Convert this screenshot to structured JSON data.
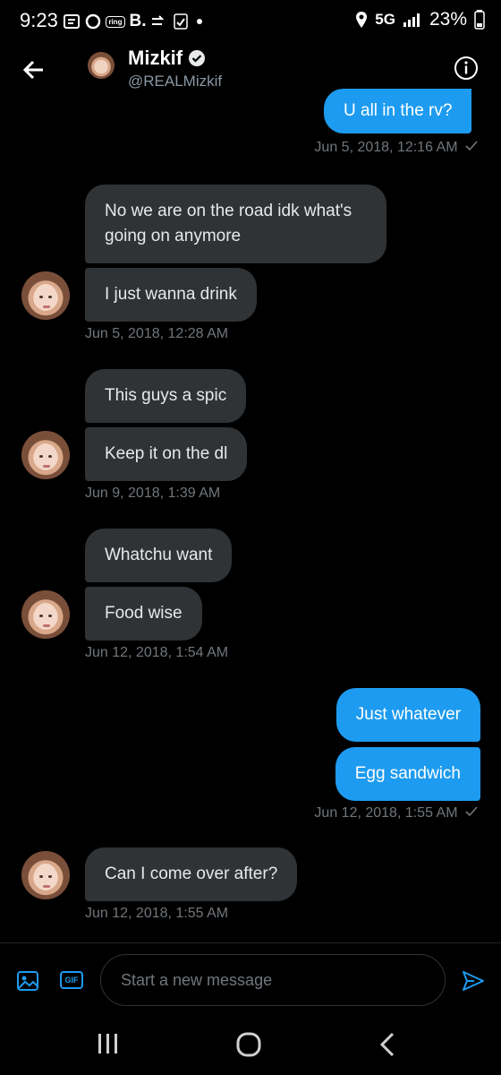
{
  "status_bar": {
    "time": "9:23",
    "notif_icons": [
      "message-icon",
      "circle-icon",
      "ring-icon",
      "b-icon",
      "arrow-icon",
      "checklist-icon",
      "dot-icon"
    ],
    "ring_label": "ring",
    "b_label": "B.",
    "network": "5G",
    "battery": "23%"
  },
  "header": {
    "name": "Mizkif",
    "handle": "@REALMizkif"
  },
  "messages": [
    {
      "dir": "out",
      "text": "U all in the rv?"
    },
    {
      "dir": "stamp_out",
      "text": "Jun 5, 2018, 12:16 AM"
    },
    {
      "dir": "in",
      "text": "No we are on the road idk what's going on anymore"
    },
    {
      "dir": "in",
      "text": "I just wanna drink"
    },
    {
      "dir": "stamp_in",
      "text": "Jun 5, 2018, 12:28 AM"
    },
    {
      "dir": "in",
      "text": "This guys a spic"
    },
    {
      "dir": "in",
      "text": "Keep it on the dl"
    },
    {
      "dir": "stamp_in",
      "text": "Jun 9, 2018, 1:39 AM"
    },
    {
      "dir": "in",
      "text": "Whatchu want"
    },
    {
      "dir": "in",
      "text": "Food wise"
    },
    {
      "dir": "stamp_in",
      "text": "Jun 12, 2018, 1:54 AM"
    },
    {
      "dir": "out",
      "text": "Just whatever"
    },
    {
      "dir": "out",
      "text": "Egg sandwich"
    },
    {
      "dir": "stamp_out",
      "text": "Jun 12, 2018, 1:55 AM"
    },
    {
      "dir": "in",
      "text": "Can I come over after?"
    },
    {
      "dir": "stamp_in",
      "text": "Jun 12, 2018, 1:55 AM"
    }
  ],
  "compose": {
    "placeholder": "Start a new message",
    "gif_label": "GIF"
  },
  "colors": {
    "accent": "#1d9bf0",
    "incoming_bubble": "#2f3336",
    "background": "#000000",
    "muted_text": "#71767b"
  }
}
